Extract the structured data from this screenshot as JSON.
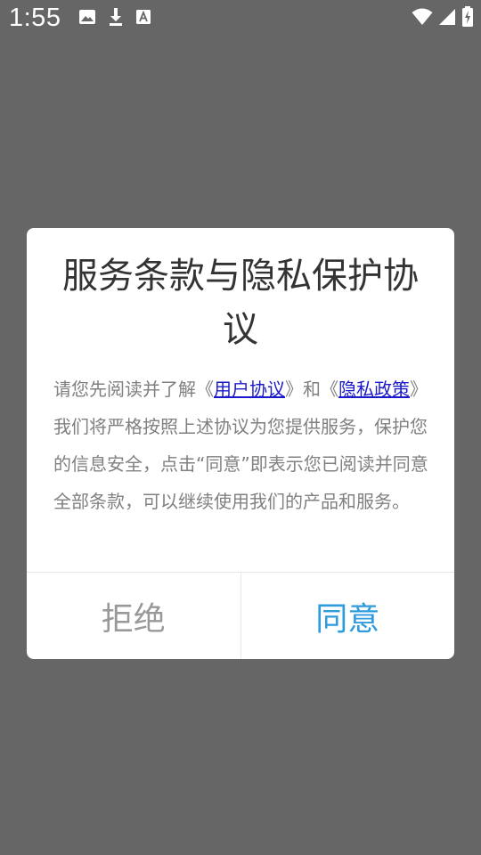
{
  "status_bar": {
    "time": "1:55",
    "left_icons": [
      "image-icon",
      "download-icon",
      "font-icon"
    ],
    "right_icons": [
      "wifi-icon",
      "signal-icon",
      "battery-charging-icon"
    ]
  },
  "dialog": {
    "title": "服务条款与隐私保护协议",
    "body": {
      "part1": "请您先阅读并了解《",
      "link_user_agreement": "用户协议",
      "part2": "》和《",
      "link_privacy_policy": "隐私政策",
      "part3": "》我们将严格按照上述协议为您提供服务，保护您的信息安全，点击“同意”即表示您已阅读并同意全部条款，可以继续使用我们的产品和服务。"
    },
    "buttons": {
      "refuse": "拒绝",
      "agree": "同意"
    }
  },
  "colors": {
    "overlay": "#666666",
    "agree": "#2e9bdc",
    "refuse": "#999999",
    "link": "#1a1acc"
  }
}
